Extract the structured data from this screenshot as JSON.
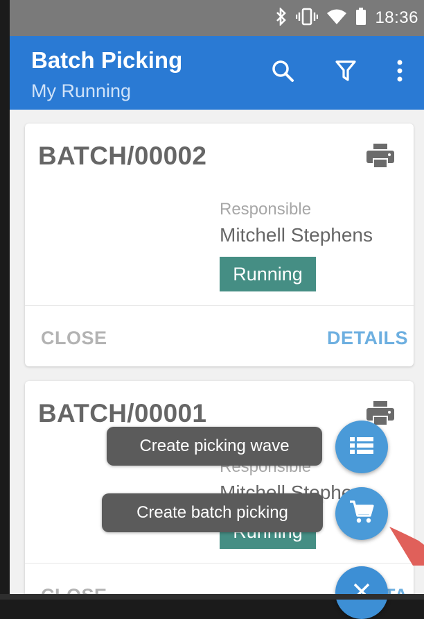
{
  "status_bar": {
    "time": "18:36",
    "icons": [
      "bluetooth-icon",
      "vibrate-icon",
      "wifi-icon",
      "battery-icon"
    ]
  },
  "app_bar": {
    "title": "Batch Picking",
    "subtitle": "My Running",
    "actions": [
      "search-icon",
      "filter-icon",
      "more-vert-icon"
    ],
    "color": "#2a7ad4"
  },
  "cards": [
    {
      "name": "BATCH/00002",
      "responsible_label": "Responsible",
      "responsible": "Mitchell Stephens",
      "state": "Running",
      "close_label": "CLOSE",
      "details_label": "DETAILS"
    },
    {
      "name": "BATCH/00001",
      "responsible_label": "Responsible",
      "responsible": "Mitchell Stephe",
      "state": "Running",
      "close_label": "CLOSE",
      "details_label": "DETA"
    }
  ],
  "fab_menu": {
    "wave_label": "Create picking wave",
    "batch_label": "Create batch picking",
    "main_icon": "close-icon",
    "accent": "#4a9ad8"
  },
  "badge_color": "#07695b"
}
